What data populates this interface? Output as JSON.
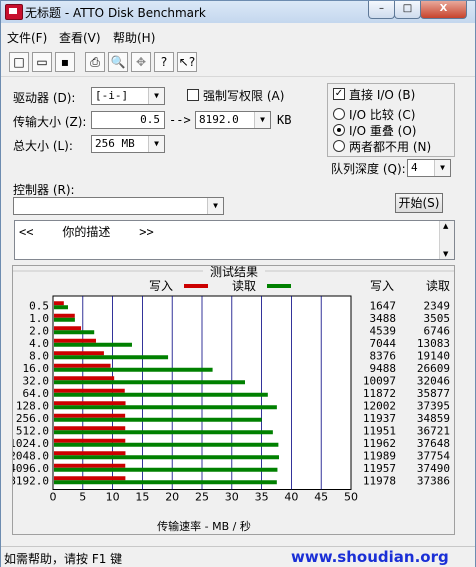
{
  "window": {
    "title": "无标题 - ATTO Disk Benchmark",
    "min": "–",
    "max": "□",
    "close": "X"
  },
  "menu": [
    "文件(F)",
    "查看(V)",
    "帮助(H)"
  ],
  "toolbar_icons": [
    "new-file-icon",
    "open-folder-icon",
    "save-icon",
    "print-icon",
    "print-preview-icon",
    "move-icon",
    "help-icon",
    "context-help-icon"
  ],
  "toolbar_glyphs": [
    "□",
    "▭",
    "▪",
    "⎙",
    "🔍",
    "✥",
    "?",
    "↖?"
  ],
  "settings": {
    "drive_label": "驱动器 (D):",
    "drive_value": "[-i-]",
    "transfer_label": "传输大小 (Z):",
    "transfer_from": "0.5",
    "arrow": "-->",
    "transfer_to": "8192.0",
    "kb": "KB",
    "total_label": "总大小 (L):",
    "total_value": "256 MB",
    "force_write_label": "强制写权限 (A)",
    "controller_label": "控制器 (R):",
    "controller_value": ""
  },
  "io": {
    "direct_label": "直接 I/O (B)",
    "direct_checked": "✓",
    "compare_label": "I/O 比较 (C)",
    "overlap_label": "I/O 重叠 (O)",
    "neither_label": "两者都不用 (N)",
    "queue_label": "队列深度 (Q):",
    "queue_value": "4"
  },
  "start_button": "开始(S)",
  "description": "<<    你的描述    >>",
  "chart_data": {
    "type": "bar",
    "title": "测试结果",
    "legend": [
      {
        "name": "写入",
        "color": "#cc0000"
      },
      {
        "name": "读取",
        "color": "#008000"
      }
    ],
    "categories": [
      "0.5",
      "1.0",
      "2.0",
      "4.0",
      "8.0",
      "16.0",
      "32.0",
      "64.0",
      "128.0",
      "256.0",
      "512.0",
      "1024.0",
      "2048.0",
      "4096.0",
      "8192.0"
    ],
    "series": [
      {
        "name": "写入",
        "values": [
          1647,
          3488,
          4539,
          7044,
          8376,
          9488,
          10097,
          11872,
          12002,
          11937,
          11951,
          11962,
          11989,
          11957,
          11978
        ]
      },
      {
        "name": "读取",
        "values": [
          2349,
          3505,
          6746,
          13083,
          19140,
          26609,
          32046,
          35877,
          37395,
          34859,
          36721,
          37648,
          37754,
          37490,
          37386
        ]
      }
    ],
    "xlabel": "传输速率 - MB / 秒",
    "xticks": [
      "0",
      "5",
      "10",
      "15",
      "20",
      "25",
      "30",
      "35",
      "40",
      "45",
      "50"
    ],
    "xlim": [
      0,
      50
    ],
    "col_write": "写入",
    "col_read": "读取",
    "grid": true
  },
  "status": {
    "text": "如需帮助，请按 F1 键",
    "watermark": "www.shoudian.org"
  }
}
